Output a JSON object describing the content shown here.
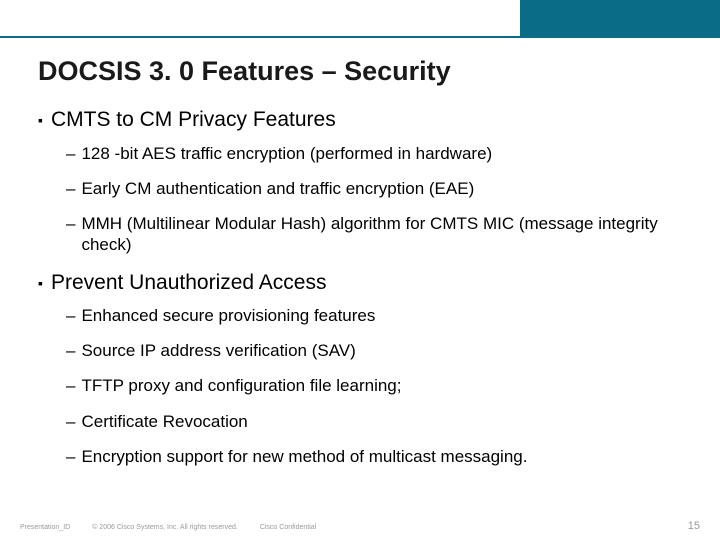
{
  "header": {
    "title": "DOCSIS 3. 0 Features – Security"
  },
  "sections": [
    {
      "heading": "CMTS to CM Privacy Features",
      "items": [
        "128 -bit AES traffic encryption (performed in hardware)",
        "Early CM authentication and traffic encryption (EAE)",
        "MMH (Multilinear Modular Hash) algorithm for CMTS MIC (message integrity check)"
      ]
    },
    {
      "heading": "Prevent Unauthorized Access",
      "items": [
        "Enhanced secure provisioning features",
        "Source IP address verification (SAV)",
        "TFTP proxy and configuration file learning;",
        "Certificate Revocation",
        "Encryption support for new method of multicast messaging."
      ]
    }
  ],
  "footer": {
    "id": "Presentation_ID",
    "copyright": "© 2006 Cisco Systems, Inc. All rights reserved.",
    "confidential": "Cisco Confidential",
    "page": "15"
  },
  "glyphs": {
    "square": "▪",
    "dash": "–"
  }
}
